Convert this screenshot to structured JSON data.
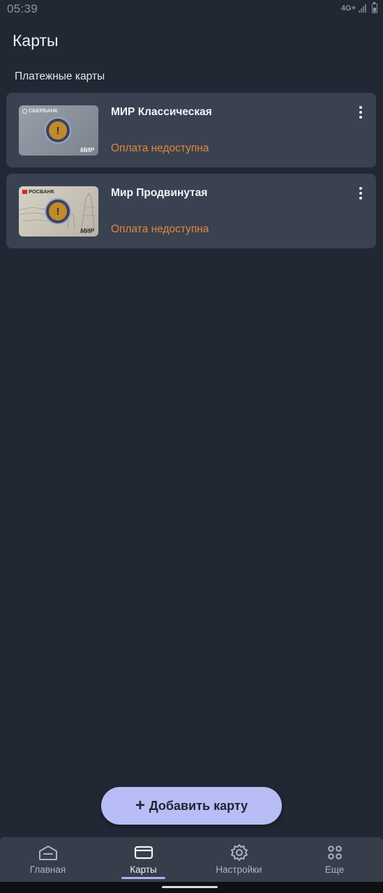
{
  "status_bar": {
    "time": "05:39",
    "network": "4G+"
  },
  "header": {
    "title": "Карты"
  },
  "section": {
    "title": "Платежные карты"
  },
  "cards": [
    {
      "name": "МИР Классическая",
      "status": "Оплата недоступна",
      "bank": "СБЕРБАНК",
      "network": "МИР"
    },
    {
      "name": "Мир Продвинутая",
      "status": "Оплата недоступна",
      "bank": "РОСБАНК",
      "network": "МИР"
    }
  ],
  "fab": {
    "plus": "+",
    "label": "Добавить карту"
  },
  "nav": [
    {
      "label": "Главная",
      "icon": "home-icon"
    },
    {
      "label": "Карты",
      "icon": "card-icon",
      "active": true
    },
    {
      "label": "Настройки",
      "icon": "gear-icon"
    },
    {
      "label": "Еще",
      "icon": "more-grid-icon"
    }
  ],
  "colors": {
    "background": "#212834",
    "card_row": "#3a4150",
    "status_warning": "#e08a38",
    "accent": "#b8bdf6",
    "nav_bg": "#363d4b"
  }
}
